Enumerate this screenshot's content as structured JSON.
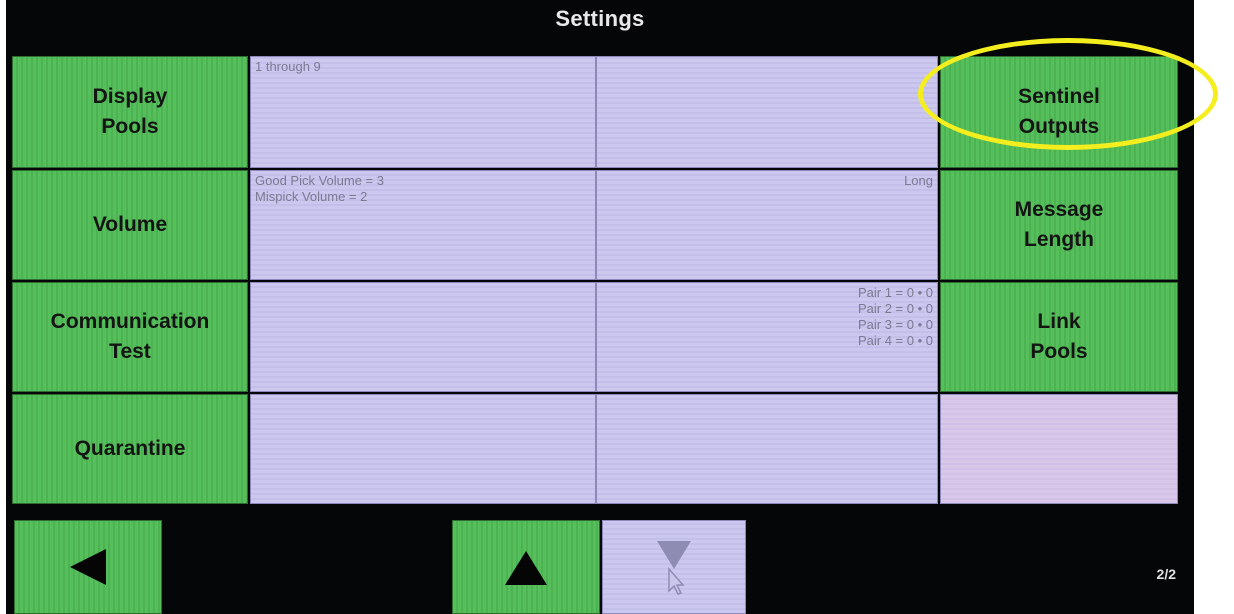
{
  "header": {
    "title": "Settings"
  },
  "buttons": {
    "display_pools": "Display\nPools",
    "volume": "Volume",
    "communication_test": "Communication\nTest",
    "quarantine": "Quarantine",
    "sentinel_outputs": "Sentinel\nOutputs",
    "message_length": "Message\nLength",
    "link_pools": "Link\nPools"
  },
  "values": {
    "display_pools": "1 through 9",
    "volume": "Good Pick Volume = 3\nMispick Volume = 2",
    "message_length": "Long",
    "link_pools": "Pair 1 = 0 • 0\nPair 2 = 0 • 0\nPair 3 = 0 • 0\nPair 4 = 0 • 0"
  },
  "footer": {
    "page_indicator": "2/2"
  },
  "icons": {
    "back": "triangle-left-icon",
    "page_up": "triangle-up-icon",
    "page_down": "triangle-down-icon",
    "cursor": "cursor-arrow-icon"
  },
  "colors": {
    "button_green": "#55bf5b",
    "value_lavender": "#cbc7ef",
    "highlight_yellow": "#f4ee1f",
    "background": "#050607"
  }
}
